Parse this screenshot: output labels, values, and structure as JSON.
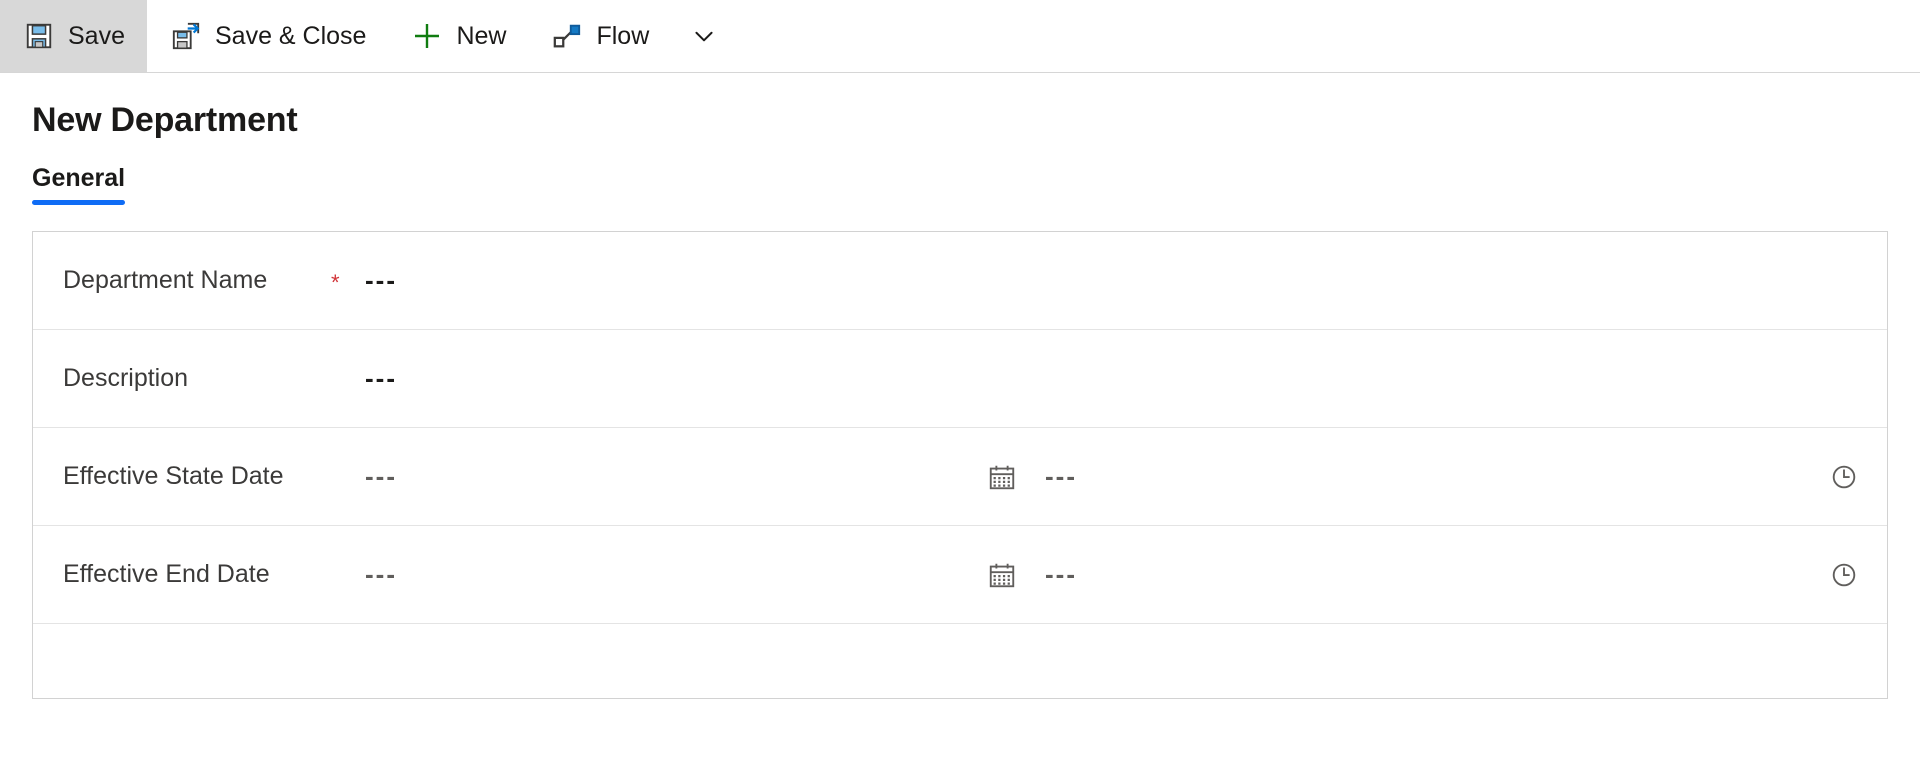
{
  "commandbar": {
    "buttons": [
      {
        "label": "Save",
        "icon": "save-floppy-icon",
        "active": true
      },
      {
        "label": "Save & Close",
        "icon": "save-and-close-icon",
        "active": false
      },
      {
        "label": "New",
        "icon": "plus-icon",
        "active": false
      },
      {
        "label": "Flow",
        "icon": "flow-icon",
        "active": false
      }
    ],
    "overflow_icon": "chevron-down-icon"
  },
  "page": {
    "title": "New Department"
  },
  "tabs": [
    {
      "label": "General",
      "selected": true
    }
  ],
  "form": {
    "rows": [
      {
        "label": "Department Name",
        "required": "*",
        "value": "---"
      },
      {
        "label": "Description",
        "required": "",
        "value": "---"
      },
      {
        "label": "Effective State Date",
        "required": "",
        "value": "---",
        "calendar_icon": "calendar-icon",
        "time_value": "---",
        "clock_icon": "clock-icon"
      },
      {
        "label": "Effective End Date",
        "required": "",
        "value": "---",
        "calendar_icon": "calendar-icon",
        "time_value": "---",
        "clock_icon": "clock-icon"
      }
    ]
  },
  "colors": {
    "accent": "#0f6cf5",
    "required": "#d13438",
    "icon_blue": "#0078d4",
    "icon_green": "#107c10",
    "active_bg": "#d8d8d8",
    "border": "#d2d2d2",
    "row_divider": "#e4e4e4"
  }
}
